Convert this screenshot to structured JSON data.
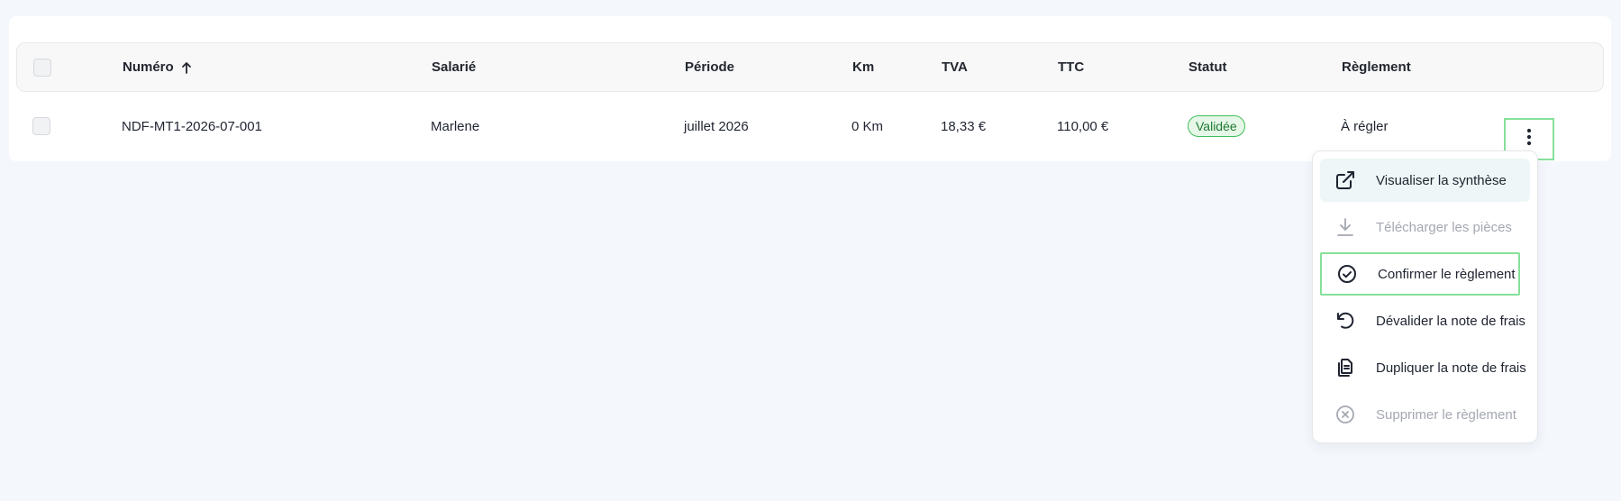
{
  "table": {
    "columns": {
      "numero": "Numéro",
      "salarie": "Salarié",
      "periode": "Période",
      "km": "Km",
      "tva": "TVA",
      "ttc": "TTC",
      "statut": "Statut",
      "reglement": "Règlement"
    },
    "sort_icon": "arrow-up-icon",
    "rows": [
      {
        "numero": "NDF-MT1-2026-07-001",
        "salarie": "Marlene",
        "periode": "juillet 2026",
        "km": "0 Km",
        "tva": "18,33 €",
        "ttc": "110,00 €",
        "statut": "Validée",
        "reglement": "À régler"
      }
    ]
  },
  "actions_menu": {
    "trigger_icon": "kebab-vertical-icon",
    "items": [
      {
        "label": "Visualiser la synthèse",
        "icon": "external-link-icon",
        "state": "hover"
      },
      {
        "label": "Télécharger les pièces",
        "icon": "download-icon",
        "state": "disabled"
      },
      {
        "label": "Confirmer le règlement",
        "icon": "check-circle-icon",
        "state": "focused"
      },
      {
        "label": "Dévalider la note de frais",
        "icon": "undo-icon",
        "state": "normal"
      },
      {
        "label": "Dupliquer la note de frais",
        "icon": "duplicate-icon",
        "state": "normal"
      },
      {
        "label": "Supprimer le règlement",
        "icon": "x-circle-icon",
        "state": "disabled"
      }
    ]
  },
  "colors": {
    "page_bg": "#f4f7fc",
    "badge_border": "#3fbf5a",
    "badge_bg": "#e6f7e8",
    "focus_outline": "#86e09a",
    "disabled_text": "#a4a8b1"
  }
}
